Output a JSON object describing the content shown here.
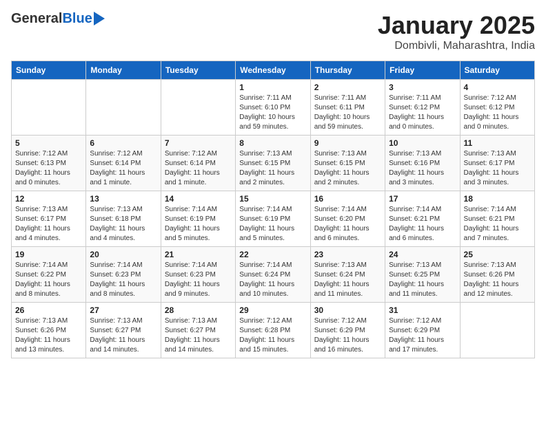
{
  "header": {
    "logo_general": "General",
    "logo_blue": "Blue",
    "title": "January 2025",
    "subtitle": "Dombivli, Maharashtra, India"
  },
  "days_of_week": [
    "Sunday",
    "Monday",
    "Tuesday",
    "Wednesday",
    "Thursday",
    "Friday",
    "Saturday"
  ],
  "weeks": [
    [
      {
        "day": "",
        "info": ""
      },
      {
        "day": "",
        "info": ""
      },
      {
        "day": "",
        "info": ""
      },
      {
        "day": "1",
        "info": "Sunrise: 7:11 AM\nSunset: 6:10 PM\nDaylight: 10 hours and 59 minutes."
      },
      {
        "day": "2",
        "info": "Sunrise: 7:11 AM\nSunset: 6:11 PM\nDaylight: 10 hours and 59 minutes."
      },
      {
        "day": "3",
        "info": "Sunrise: 7:11 AM\nSunset: 6:12 PM\nDaylight: 11 hours and 0 minutes."
      },
      {
        "day": "4",
        "info": "Sunrise: 7:12 AM\nSunset: 6:12 PM\nDaylight: 11 hours and 0 minutes."
      }
    ],
    [
      {
        "day": "5",
        "info": "Sunrise: 7:12 AM\nSunset: 6:13 PM\nDaylight: 11 hours and 0 minutes."
      },
      {
        "day": "6",
        "info": "Sunrise: 7:12 AM\nSunset: 6:14 PM\nDaylight: 11 hours and 1 minute."
      },
      {
        "day": "7",
        "info": "Sunrise: 7:12 AM\nSunset: 6:14 PM\nDaylight: 11 hours and 1 minute."
      },
      {
        "day": "8",
        "info": "Sunrise: 7:13 AM\nSunset: 6:15 PM\nDaylight: 11 hours and 2 minutes."
      },
      {
        "day": "9",
        "info": "Sunrise: 7:13 AM\nSunset: 6:15 PM\nDaylight: 11 hours and 2 minutes."
      },
      {
        "day": "10",
        "info": "Sunrise: 7:13 AM\nSunset: 6:16 PM\nDaylight: 11 hours and 3 minutes."
      },
      {
        "day": "11",
        "info": "Sunrise: 7:13 AM\nSunset: 6:17 PM\nDaylight: 11 hours and 3 minutes."
      }
    ],
    [
      {
        "day": "12",
        "info": "Sunrise: 7:13 AM\nSunset: 6:17 PM\nDaylight: 11 hours and 4 minutes."
      },
      {
        "day": "13",
        "info": "Sunrise: 7:13 AM\nSunset: 6:18 PM\nDaylight: 11 hours and 4 minutes."
      },
      {
        "day": "14",
        "info": "Sunrise: 7:14 AM\nSunset: 6:19 PM\nDaylight: 11 hours and 5 minutes."
      },
      {
        "day": "15",
        "info": "Sunrise: 7:14 AM\nSunset: 6:19 PM\nDaylight: 11 hours and 5 minutes."
      },
      {
        "day": "16",
        "info": "Sunrise: 7:14 AM\nSunset: 6:20 PM\nDaylight: 11 hours and 6 minutes."
      },
      {
        "day": "17",
        "info": "Sunrise: 7:14 AM\nSunset: 6:21 PM\nDaylight: 11 hours and 6 minutes."
      },
      {
        "day": "18",
        "info": "Sunrise: 7:14 AM\nSunset: 6:21 PM\nDaylight: 11 hours and 7 minutes."
      }
    ],
    [
      {
        "day": "19",
        "info": "Sunrise: 7:14 AM\nSunset: 6:22 PM\nDaylight: 11 hours and 8 minutes."
      },
      {
        "day": "20",
        "info": "Sunrise: 7:14 AM\nSunset: 6:23 PM\nDaylight: 11 hours and 8 minutes."
      },
      {
        "day": "21",
        "info": "Sunrise: 7:14 AM\nSunset: 6:23 PM\nDaylight: 11 hours and 9 minutes."
      },
      {
        "day": "22",
        "info": "Sunrise: 7:14 AM\nSunset: 6:24 PM\nDaylight: 11 hours and 10 minutes."
      },
      {
        "day": "23",
        "info": "Sunrise: 7:13 AM\nSunset: 6:24 PM\nDaylight: 11 hours and 11 minutes."
      },
      {
        "day": "24",
        "info": "Sunrise: 7:13 AM\nSunset: 6:25 PM\nDaylight: 11 hours and 11 minutes."
      },
      {
        "day": "25",
        "info": "Sunrise: 7:13 AM\nSunset: 6:26 PM\nDaylight: 11 hours and 12 minutes."
      }
    ],
    [
      {
        "day": "26",
        "info": "Sunrise: 7:13 AM\nSunset: 6:26 PM\nDaylight: 11 hours and 13 minutes."
      },
      {
        "day": "27",
        "info": "Sunrise: 7:13 AM\nSunset: 6:27 PM\nDaylight: 11 hours and 14 minutes."
      },
      {
        "day": "28",
        "info": "Sunrise: 7:13 AM\nSunset: 6:27 PM\nDaylight: 11 hours and 14 minutes."
      },
      {
        "day": "29",
        "info": "Sunrise: 7:12 AM\nSunset: 6:28 PM\nDaylight: 11 hours and 15 minutes."
      },
      {
        "day": "30",
        "info": "Sunrise: 7:12 AM\nSunset: 6:29 PM\nDaylight: 11 hours and 16 minutes."
      },
      {
        "day": "31",
        "info": "Sunrise: 7:12 AM\nSunset: 6:29 PM\nDaylight: 11 hours and 17 minutes."
      },
      {
        "day": "",
        "info": ""
      }
    ]
  ]
}
